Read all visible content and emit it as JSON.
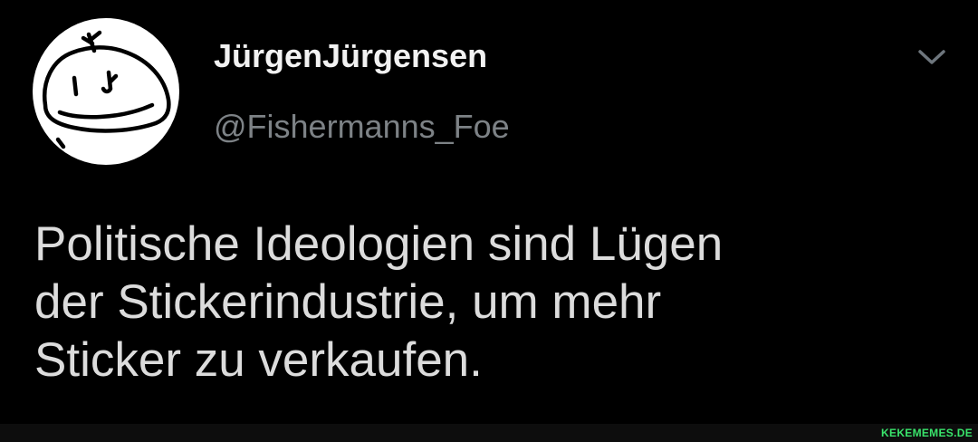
{
  "tweet": {
    "display_name": "JürgenJürgensen",
    "handle": "@Fishermanns_Foe",
    "text_lines": [
      "Politische Ideologien sind Lügen",
      "der Stickerindustrie, um mehr",
      "Sticker zu verkaufen."
    ],
    "menu_icon": "chevron-down-icon",
    "avatar_icon": "hand-drawn-smiley-face"
  },
  "footer": {
    "watermark": "KEKEMEMES.DE"
  },
  "colors": {
    "background": "#000000",
    "name": "#f2f2f2",
    "handle": "#7d8286",
    "body_text": "#dcdcdc",
    "watermark": "#39e36b"
  }
}
